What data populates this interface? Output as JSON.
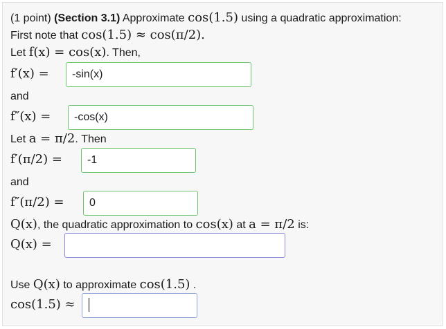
{
  "problem": {
    "points": "(1 point)",
    "section": "(Section 3.1)",
    "prompt_text": "Approximate",
    "prompt_expr": "cos(1.5)",
    "prompt_tail": "using a quadratic approximation:",
    "note_text": "First note that",
    "note_expr": "cos(1.5) ≈ cos(π/2).",
    "let_text": "Let",
    "let_expr": "f(x) = cos(x)",
    "let_tail": ". Then,",
    "and_1": "and",
    "let_a_text": "Let",
    "let_a_expr": "a = π/2",
    "let_a_tail": ". Then",
    "and_2": "and",
    "q_expr": "Q(x)",
    "q_text": ", the quadratic approximation to",
    "q_cos_expr": "cos(x)",
    "q_at_text": "at",
    "q_a_expr": "a = π/2",
    "q_is_text": "is:",
    "use_text": "Use",
    "use_expr": "Q(x)",
    "use_mid_text": "to approximate",
    "use_cos_expr": "cos(1.5)",
    "use_tail": "."
  },
  "fields": {
    "f_prime_x": {
      "label": "f′(x) =",
      "value": "-sin(x)"
    },
    "f_double_prime_x": {
      "label": "f″(x) =",
      "value": "-cos(x)"
    },
    "f_prime_a": {
      "label": "f′(π/2) =",
      "value": "-1"
    },
    "f_double_prime_a": {
      "label": "f″(π/2) =",
      "value": "0"
    },
    "q_x": {
      "label": "Q(x) =",
      "value": ""
    },
    "cos_approx": {
      "label": "cos(1.5) ≈",
      "value": ""
    }
  },
  "colors": {
    "correct_border": "#6cc36c",
    "empty_border": "#8a8ad8",
    "panel_bg": "#f7f7f7"
  }
}
